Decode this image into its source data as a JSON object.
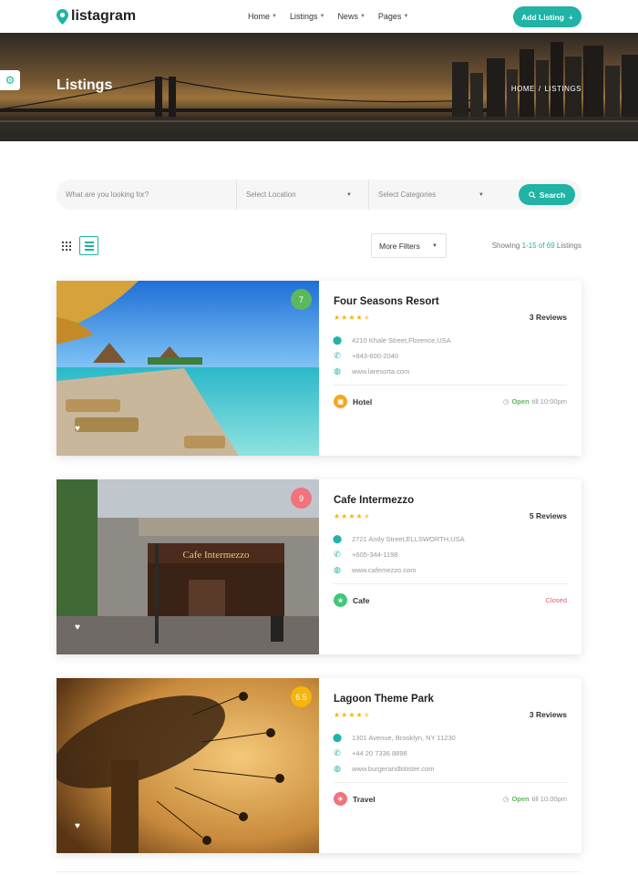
{
  "header": {
    "logo_text": "listagram",
    "nav": [
      {
        "label": "Home"
      },
      {
        "label": "Listings"
      },
      {
        "label": "News"
      },
      {
        "label": "Pages"
      }
    ],
    "add_listing_label": "Add Listing",
    "add_icon": "+"
  },
  "hero": {
    "title": "Listings",
    "breadcrumb_home": "HOME",
    "breadcrumb_sep": "/",
    "breadcrumb_current": "LISTINGS"
  },
  "search": {
    "what_placeholder": "What are you looking for?",
    "location_placeholder": "Select Location",
    "category_placeholder": "Select Categories",
    "button_label": "Search"
  },
  "toolbar": {
    "more_filters_label": "More Filters",
    "showing_prefix": "Showing",
    "showing_range": "1-15 of 69",
    "showing_suffix": "Listings"
  },
  "listings": [
    {
      "title": "Four Seasons Resort",
      "rating": "7",
      "rating_color": "#5cb85c",
      "reviews": "3 Reviews",
      "address": "4210 Khale Street,Florence,USA",
      "phone": "+843-600-2040",
      "website": "www.laresorta.com",
      "category": "Hotel",
      "category_color": "#f5a623",
      "status_word": "Open",
      "status_rest": "till 10:00pm"
    },
    {
      "title": "Cafe Intermezzo",
      "rating": "9",
      "rating_color": "#f2727d",
      "reviews": "5 Reviews",
      "address": "2721 Andy Street,ELLSWORTH,USA",
      "phone": "+605-344-1198",
      "website": "www.cafemezzo.com",
      "category": "Cafe",
      "category_color": "#3ec97a",
      "status_word": "Closed",
      "status_rest": ""
    },
    {
      "title": "Lagoon Theme Park",
      "rating": "6.5",
      "rating_color": "#f5b50b",
      "reviews": "3 Reviews",
      "address": "1301 Avenue, Brooklyn, NY 11230",
      "phone": "+44 20 7336 8898",
      "website": "www.burgerandlobster.com",
      "category": "Travel",
      "category_color": "#f2727d",
      "status_word": "Open",
      "status_rest": "till 10.00pm"
    }
  ],
  "colors": {
    "accent": "#20b3a6",
    "star": "#f5b50b"
  }
}
